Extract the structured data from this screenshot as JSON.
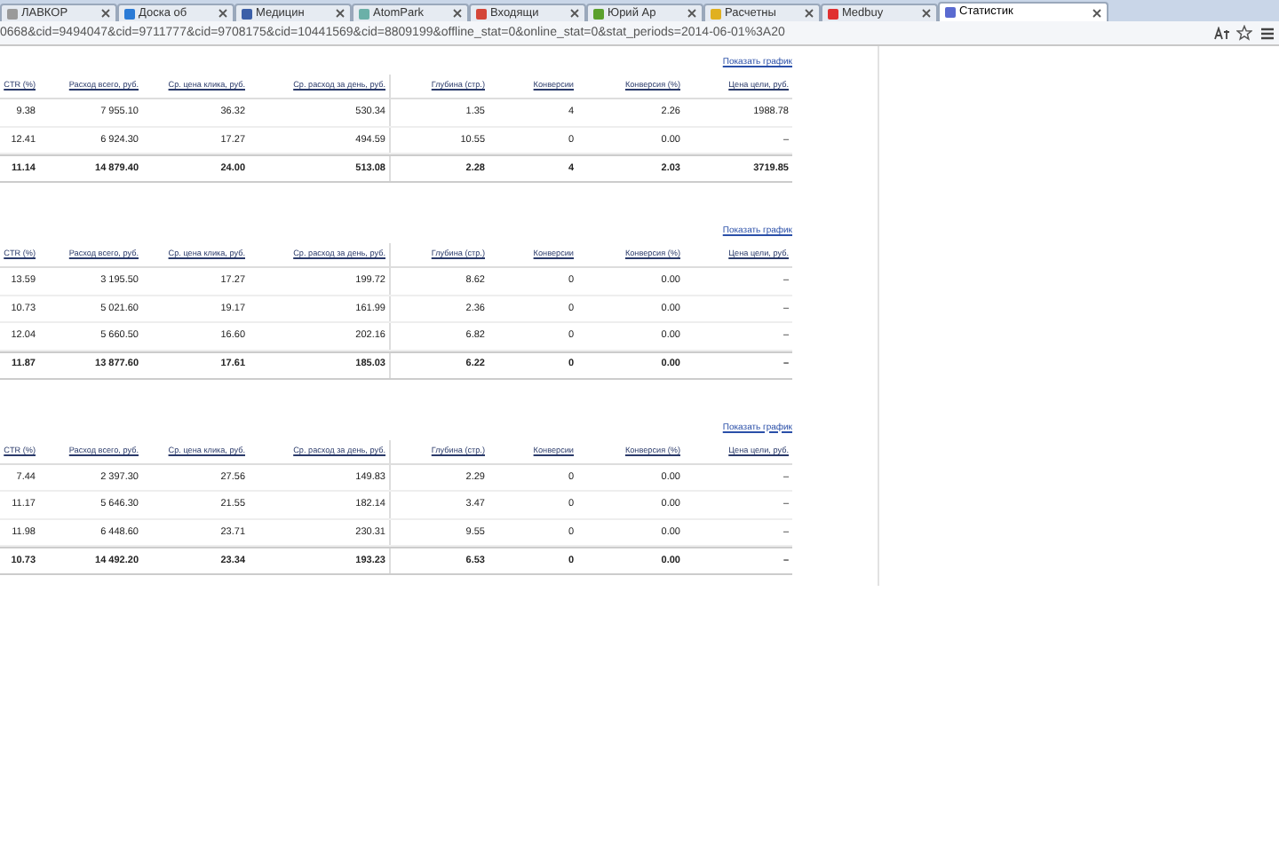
{
  "tabs": [
    {
      "label": "ЛАВКОР",
      "selected": false,
      "color": "#9a9a9a"
    },
    {
      "label": "Доска об",
      "selected": false,
      "color": "#2b7bd6"
    },
    {
      "label": "Медицин",
      "selected": false,
      "color": "#3b5fa8"
    },
    {
      "label": "AtomPark",
      "selected": false,
      "color": "#6bb0a8"
    },
    {
      "label": "Входящи",
      "selected": false,
      "color": "#d44638"
    },
    {
      "label": "Юрий Ар",
      "selected": false,
      "color": "#5aa02c"
    },
    {
      "label": "Расчетны",
      "selected": false,
      "color": "#e0b020"
    },
    {
      "label": "Medbuy",
      "selected": false,
      "color": "#e03030"
    },
    {
      "label": "Статистик",
      "selected": true,
      "color": "#5a6ad0"
    }
  ],
  "address_bar": {
    "value": "0668&cid=9494047&cid=9711777&cid=9708175&cid=10441569&cid=8809199&offline_stat=0&online_stat=0&stat_periods=2014-06-01%3A20"
  },
  "sections": [
    {
      "link": "Показать график",
      "columns": [
        "CTR (%)",
        "Расход всего, руб.",
        "Ср. цена клика, руб.",
        "Ср. расход за день, руб.",
        "Глубина (стр.)",
        "Конверсии",
        "Конверсия (%)",
        "Цена цели, руб."
      ],
      "rows": [
        [
          "9.38",
          "7 955.10",
          "36.32",
          "530.34",
          "1.35",
          "4",
          "2.26",
          "1988.78"
        ],
        [
          "12.41",
          "6 924.30",
          "17.27",
          "494.59",
          "10.55",
          "0",
          "0.00",
          "–"
        ]
      ],
      "total": [
        "11.14",
        "14 879.40",
        "24.00",
        "513.08",
        "2.28",
        "4",
        "2.03",
        "3719.85"
      ]
    },
    {
      "link": "Показать график",
      "columns": [
        "CTR (%)",
        "Расход всего, руб.",
        "Ср. цена клика, руб.",
        "Ср. расход за день, руб.",
        "Глубина (стр.)",
        "Конверсии",
        "Конверсия (%)",
        "Цена цели, руб."
      ],
      "rows": [
        [
          "13.59",
          "3 195.50",
          "17.27",
          "199.72",
          "8.62",
          "0",
          "0.00",
          "–"
        ],
        [
          "10.73",
          "5 021.60",
          "19.17",
          "161.99",
          "2.36",
          "0",
          "0.00",
          "–"
        ],
        [
          "12.04",
          "5 660.50",
          "16.60",
          "202.16",
          "6.82",
          "0",
          "0.00",
          "–"
        ]
      ],
      "total": [
        "11.87",
        "13 877.60",
        "17.61",
        "185.03",
        "6.22",
        "0",
        "0.00",
        "–"
      ]
    },
    {
      "link": "Показать график",
      "columns": [
        "CTR (%)",
        "Расход всего, руб.",
        "Ср. цена клика, руб.",
        "Ср. расход за день, руб.",
        "Глубина (стр.)",
        "Конверсии",
        "Конверсия (%)",
        "Цена цели, руб."
      ],
      "rows": [
        [
          "7.44",
          "2 397.30",
          "27.56",
          "149.83",
          "2.29",
          "0",
          "0.00",
          "–"
        ],
        [
          "11.17",
          "5 646.30",
          "21.55",
          "182.14",
          "3.47",
          "0",
          "0.00",
          "–"
        ],
        [
          "11.98",
          "6 448.60",
          "23.71",
          "230.31",
          "9.55",
          "0",
          "0.00",
          "–"
        ]
      ],
      "total": [
        "10.73",
        "14 492.20",
        "23.34",
        "193.23",
        "6.53",
        "0",
        "0.00",
        "–"
      ]
    }
  ]
}
